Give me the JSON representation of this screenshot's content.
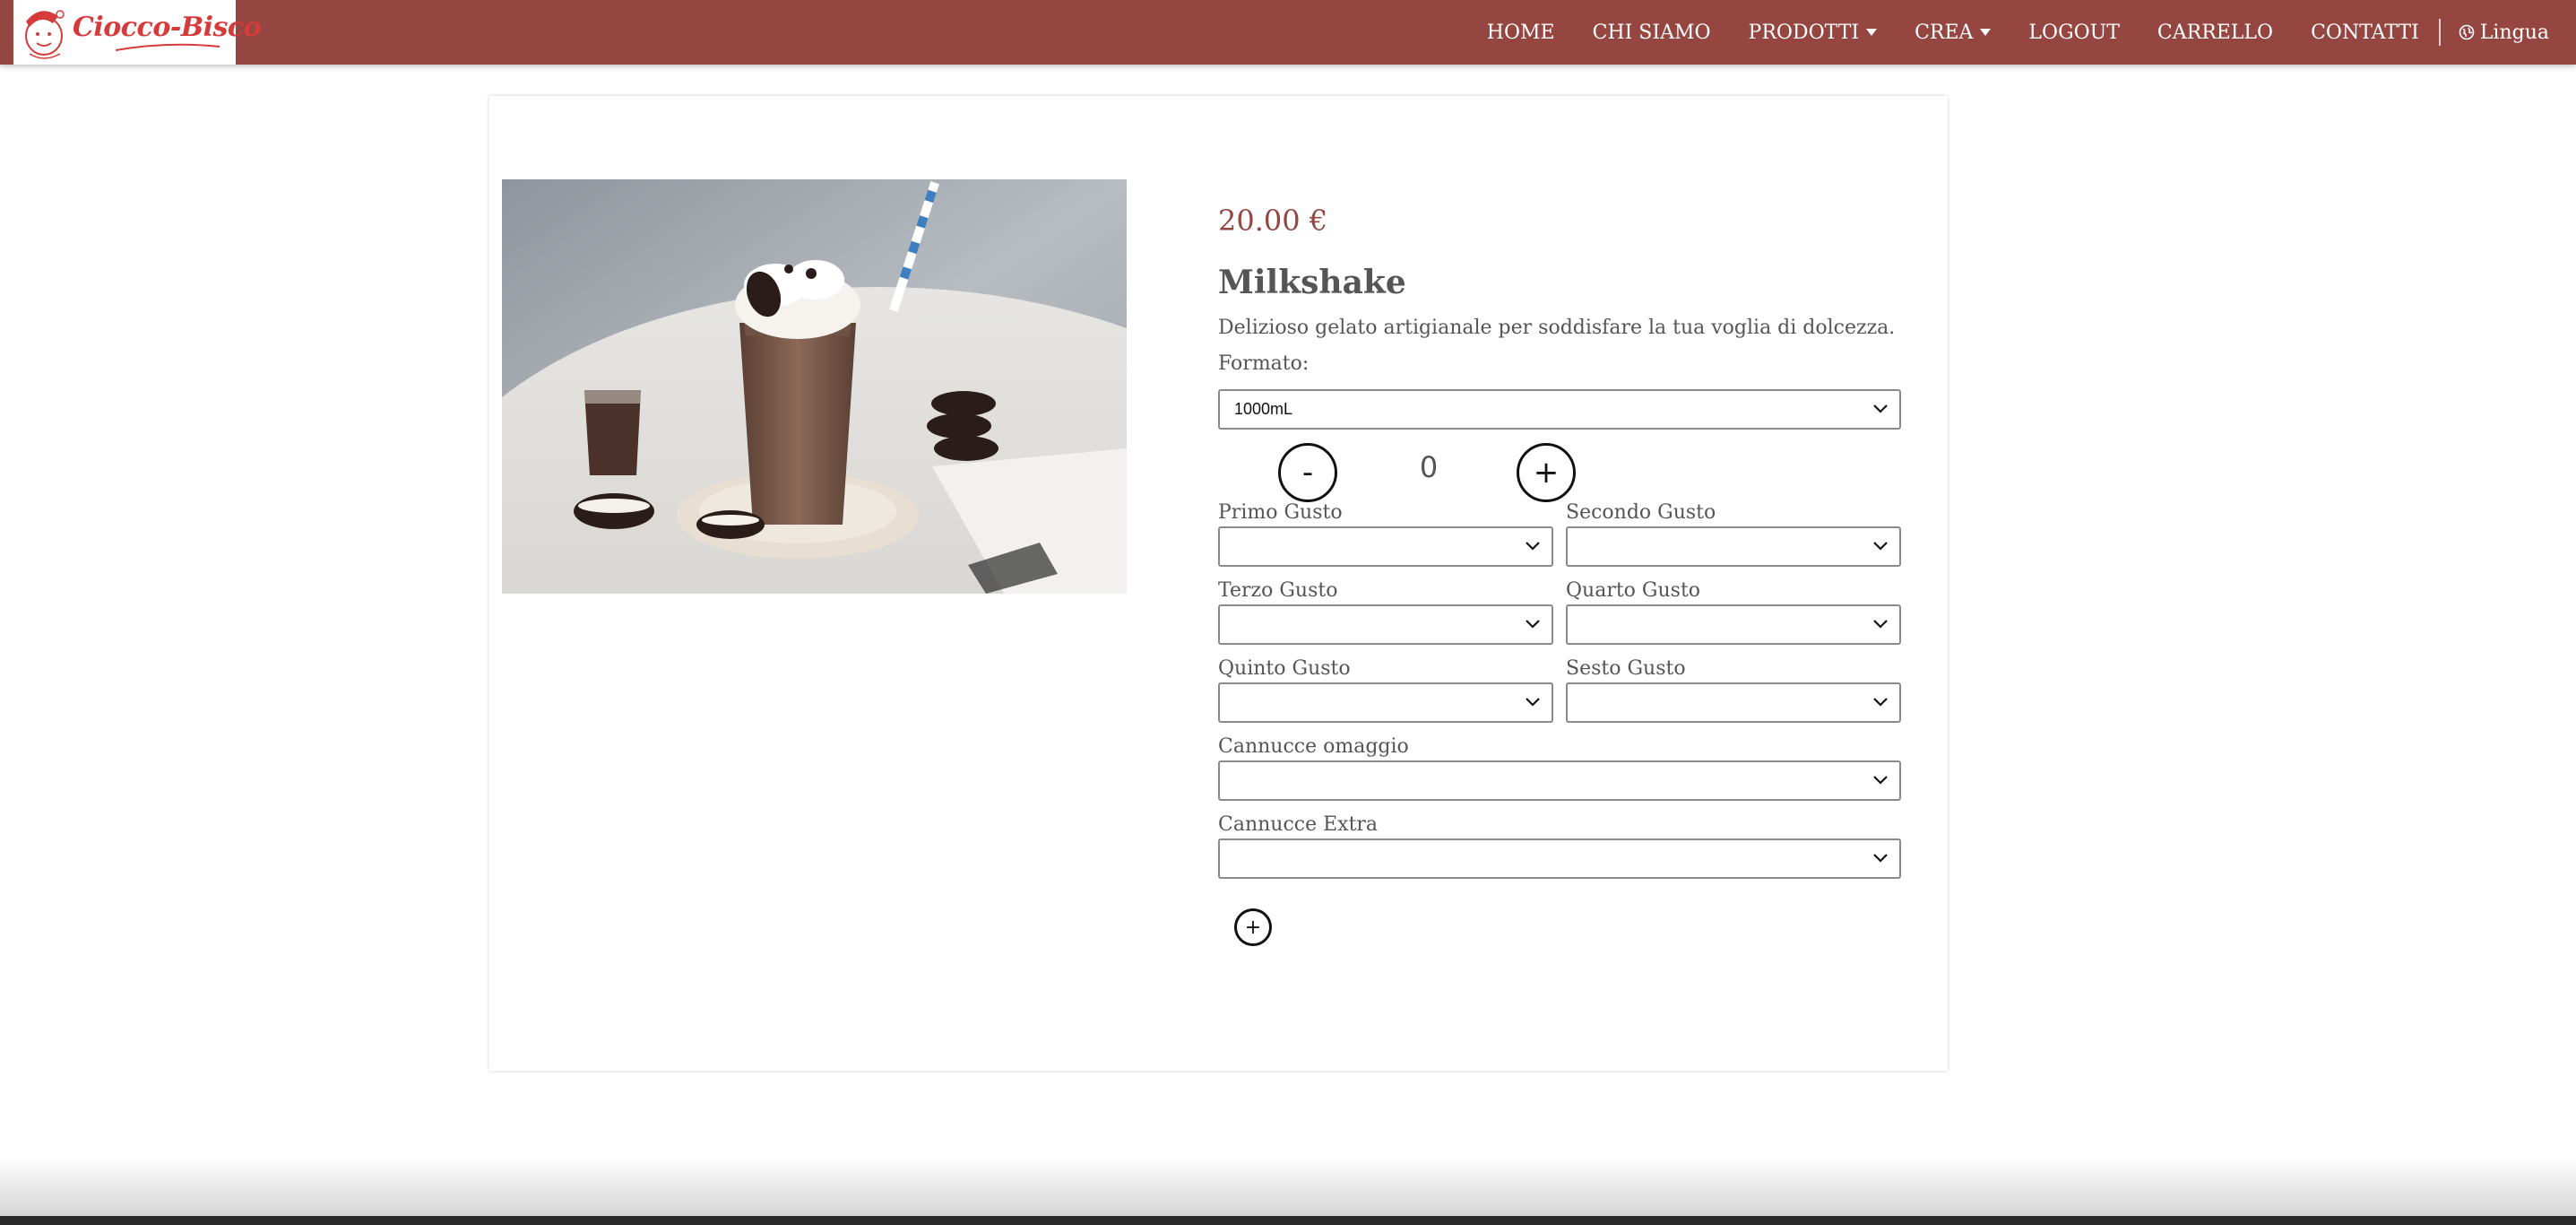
{
  "brand": {
    "name": "Ciocco-Bisco",
    "color": "#964640",
    "accent": "#d63a3a"
  },
  "nav": {
    "items": [
      {
        "label": "HOME"
      },
      {
        "label": "CHI SIAMO"
      },
      {
        "label": "PRODOTTI",
        "dropdown": true
      },
      {
        "label": "CREA",
        "dropdown": true
      },
      {
        "label": "LOGOUT"
      },
      {
        "label": "CARRELLO"
      },
      {
        "label": "CONTATTI"
      }
    ],
    "language_label": "Lingua",
    "language_icon": "globe-icon"
  },
  "product": {
    "price": "20.00 €",
    "name": "Milkshake",
    "description": "Delizioso gelato artigianale per soddisfare la tua voglia di dolcezza.",
    "image_alt": "milkshake-photo",
    "format": {
      "label": "Formato:",
      "selected": "1000mL"
    },
    "quantity": {
      "value": "0",
      "minus_label": "-",
      "plus_label": "+"
    },
    "flavors": {
      "first": {
        "label": "Primo Gusto",
        "selected": ""
      },
      "second": {
        "label": "Secondo Gusto",
        "selected": ""
      },
      "third": {
        "label": "Terzo Gusto",
        "selected": ""
      },
      "fourth": {
        "label": "Quarto Gusto",
        "selected": ""
      },
      "fifth": {
        "label": "Quinto Gusto",
        "selected": ""
      },
      "sixth": {
        "label": "Sesto Gusto",
        "selected": ""
      }
    },
    "straws_free": {
      "label": "Cannucce omaggio",
      "selected": ""
    },
    "straws_extra": {
      "label": "Cannucce Extra",
      "selected": ""
    },
    "add_label": "+"
  }
}
